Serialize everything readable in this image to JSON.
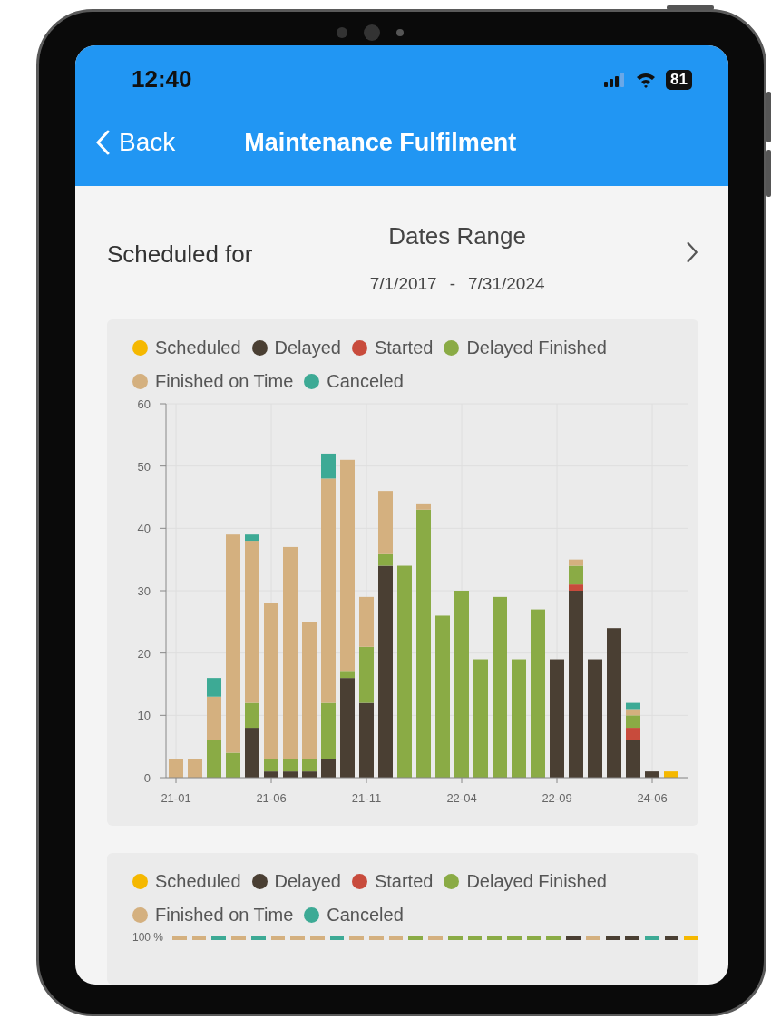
{
  "status_bar": {
    "time": "12:40",
    "battery": "81"
  },
  "nav": {
    "back": "Back",
    "title": "Maintenance Fulfilment"
  },
  "filter": {
    "label": "Scheduled for",
    "range_title": "Dates Range",
    "start": "7/1/2017",
    "separator": "-",
    "end": "7/31/2024"
  },
  "chart": {
    "chart_data": {
      "type": "bar",
      "stacked": true,
      "grid": true,
      "categories": [
        "21-01",
        null,
        null,
        null,
        null,
        "21-06",
        null,
        null,
        null,
        null,
        "21-11",
        null,
        null,
        null,
        null,
        "22-04",
        null,
        null,
        null,
        null,
        "22-09",
        null,
        null,
        null,
        null,
        "24-06",
        null
      ],
      "ylim": [
        0,
        60
      ],
      "yticks": [
        0,
        10,
        20,
        30,
        40,
        50,
        60
      ],
      "series": [
        {
          "name": "Scheduled",
          "color": "#f5b800",
          "values": [
            0,
            0,
            0,
            0,
            0,
            0,
            0,
            0,
            0,
            0,
            0,
            0,
            0,
            0,
            0,
            0,
            0,
            0,
            0,
            0,
            0,
            0,
            0,
            0,
            0,
            0,
            1
          ]
        },
        {
          "name": "Delayed",
          "color": "#4a3f33",
          "values": [
            0,
            0,
            0,
            0,
            8,
            1,
            1,
            1,
            3,
            16,
            12,
            34,
            0,
            0,
            0,
            0,
            0,
            0,
            0,
            0,
            19,
            30,
            19,
            24,
            6,
            1,
            0
          ]
        },
        {
          "name": "Started",
          "color": "#c84b3c",
          "values": [
            0,
            0,
            0,
            0,
            0,
            0,
            0,
            0,
            0,
            0,
            0,
            0,
            0,
            0,
            0,
            0,
            0,
            0,
            0,
            0,
            0,
            1,
            0,
            0,
            2,
            0,
            0
          ]
        },
        {
          "name": "Delayed Finished",
          "color": "#8aab45",
          "values": [
            0,
            0,
            6,
            4,
            4,
            2,
            2,
            2,
            9,
            1,
            9,
            2,
            34,
            43,
            26,
            30,
            19,
            29,
            19,
            27,
            0,
            3,
            0,
            0,
            2,
            0,
            0
          ]
        },
        {
          "name": "Finished on Time",
          "color": "#d4b07f",
          "values": [
            3,
            3,
            7,
            35,
            26,
            25,
            34,
            22,
            36,
            34,
            8,
            10,
            0,
            1,
            0,
            0,
            0,
            0,
            0,
            0,
            0,
            1,
            0,
            0,
            1,
            0,
            0
          ]
        },
        {
          "name": "Canceled",
          "color": "#3daa95",
          "values": [
            0,
            0,
            3,
            0,
            1,
            0,
            0,
            0,
            4,
            0,
            0,
            0,
            0,
            0,
            0,
            0,
            0,
            0,
            0,
            0,
            0,
            0,
            0,
            0,
            1,
            0,
            0
          ]
        }
      ]
    }
  },
  "chart_2": {
    "legend": [
      {
        "name": "Scheduled",
        "color": "#f5b800"
      },
      {
        "name": "Delayed",
        "color": "#4a3f33"
      },
      {
        "name": "Started",
        "color": "#c84b3c"
      },
      {
        "name": "Delayed Finished",
        "color": "#8aab45"
      },
      {
        "name": "Finished on Time",
        "color": "#d4b07f"
      },
      {
        "name": "Canceled",
        "color": "#3daa95"
      }
    ],
    "ytick_label": "100 %",
    "bar_tops": [
      {
        "color": "#d4b07f"
      },
      {
        "color": "#d4b07f"
      },
      {
        "color": "#3daa95"
      },
      {
        "color": "#d4b07f"
      },
      {
        "color": "#3daa95"
      },
      {
        "color": "#d4b07f"
      },
      {
        "color": "#d4b07f"
      },
      {
        "color": "#d4b07f"
      },
      {
        "color": "#3daa95"
      },
      {
        "color": "#d4b07f"
      },
      {
        "color": "#d4b07f"
      },
      {
        "color": "#d4b07f"
      },
      {
        "color": "#8aab45"
      },
      {
        "color": "#d4b07f"
      },
      {
        "color": "#8aab45"
      },
      {
        "color": "#8aab45"
      },
      {
        "color": "#8aab45"
      },
      {
        "color": "#8aab45"
      },
      {
        "color": "#8aab45"
      },
      {
        "color": "#8aab45"
      },
      {
        "color": "#4a3f33"
      },
      {
        "color": "#d4b07f"
      },
      {
        "color": "#4a3f33"
      },
      {
        "color": "#4a3f33"
      },
      {
        "color": "#3daa95"
      },
      {
        "color": "#4a3f33"
      },
      {
        "color": "#f5b800"
      }
    ]
  }
}
